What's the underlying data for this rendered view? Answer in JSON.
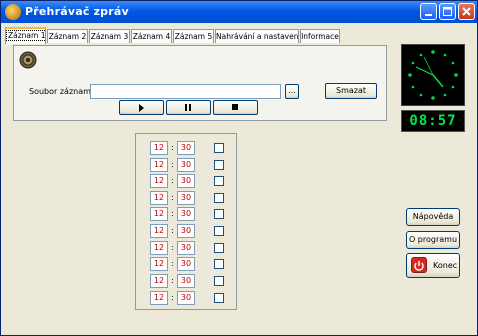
{
  "window": {
    "title": "Přehrávač zpráv"
  },
  "tabs": [
    {
      "label": "Záznam 1",
      "active": true
    },
    {
      "label": "Záznam 2",
      "active": false
    },
    {
      "label": "Záznam 3",
      "active": false
    },
    {
      "label": "Záznam 4",
      "active": false
    },
    {
      "label": "Záznam 5",
      "active": false
    },
    {
      "label": "Nahrávání a nastavení",
      "active": false
    },
    {
      "label": "Informace",
      "active": false
    }
  ],
  "record": {
    "file_label": "Soubor záznamu:",
    "file_value": "",
    "browse_label": "...",
    "delete_label": "Smazat",
    "transport": [
      {
        "name": "play",
        "icon": "play-icon"
      },
      {
        "name": "pause",
        "icon": "pause-icon"
      },
      {
        "name": "stop",
        "icon": "stop-icon"
      }
    ]
  },
  "schedule": [
    {
      "hour": "12",
      "sep": ":",
      "minute": "30",
      "enabled": false
    },
    {
      "hour": "12",
      "sep": ":",
      "minute": "30",
      "enabled": false
    },
    {
      "hour": "12",
      "sep": ":",
      "minute": "30",
      "enabled": false
    },
    {
      "hour": "12",
      "sep": ":",
      "minute": "30",
      "enabled": false
    },
    {
      "hour": "12",
      "sep": ":",
      "minute": "30",
      "enabled": false
    },
    {
      "hour": "12",
      "sep": ":",
      "minute": "30",
      "enabled": false
    },
    {
      "hour": "12",
      "sep": ":",
      "minute": "30",
      "enabled": false
    },
    {
      "hour": "12",
      "sep": ":",
      "minute": "30",
      "enabled": false
    },
    {
      "hour": "12",
      "sep": ":",
      "minute": "30",
      "enabled": false
    },
    {
      "hour": "12",
      "sep": ":",
      "minute": "30",
      "enabled": false
    }
  ],
  "clock": {
    "digital": "08:57",
    "color": "#00e64d"
  },
  "side_buttons": {
    "help_label": "Nápověda",
    "about_label": "O programu",
    "quit_label": "Konec"
  },
  "colors": {
    "title_bar": "#0058e6",
    "time_text": "#c00000",
    "clock_face": "#000000"
  }
}
